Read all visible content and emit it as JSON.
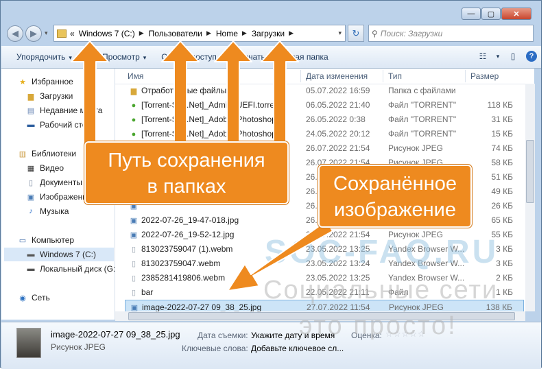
{
  "window": {
    "caption_buttons": [
      "—",
      "▢",
      "✕"
    ]
  },
  "nav": {
    "back": "◀",
    "forward": "▶",
    "dropdown": "▾"
  },
  "address": {
    "prefix": "«",
    "separator": "▶",
    "crumbs": [
      "Windows 7 (C:)",
      "Пользователи",
      "Home",
      "Загрузки"
    ],
    "dropdown": "▾"
  },
  "refresh_icon": "↻",
  "search": {
    "icon": "⚲",
    "placeholder": "Поиск: Загрузки"
  },
  "toolbar": {
    "organize": "Упорядочить",
    "preview": "Просмотр",
    "share": "Общий доступ",
    "print": "Печать",
    "new_folder": "Новая папка",
    "dropdown": "▾",
    "view_icon": "☷",
    "pane_icon": "▯",
    "help_icon": "?"
  },
  "nav_pane": {
    "favorites": "Избранное",
    "downloads": "Загрузки",
    "recent": "Недавние места",
    "desktop": "Рабочий стол",
    "libraries": "Библиотеки",
    "video": "Видео",
    "documents": "Документы",
    "images": "Изображения",
    "music": "Музыка",
    "computer": "Компьютер",
    "drive_c": "Windows 7 (C:)",
    "drive_g": "Локальный диск (G:)",
    "network": "Сеть"
  },
  "columns": {
    "name": "Имя",
    "date": "Дата изменения",
    "type": "Тип",
    "size": "Размер"
  },
  "files": [
    {
      "name": "Отработанные файлы",
      "date": "05.07.2022 16:59",
      "type": "Папка с файлами",
      "size": "",
      "icon": "folder-icon"
    },
    {
      "name": "[Torrent-Soft.Net]_Admin_UEFI.torrent",
      "date": "06.05.2022 21:40",
      "type": "Файл \"TORRENT\"",
      "size": "118 КБ",
      "icon": "torrent-icon"
    },
    {
      "name": "[Torrent-Soft.Net]_Adobe_Photoshop",
      "date": "26.05.2022 0:38",
      "type": "Файл \"TORRENT\"",
      "size": "31 КБ",
      "icon": "torrent-icon"
    },
    {
      "name": "[Torrent-Soft.Net]_Adobe_Photoshop",
      "date": "24.05.2022 20:12",
      "type": "Файл \"TORRENT\"",
      "size": "15 КБ",
      "icon": "torrent-icon"
    },
    {
      "name": "",
      "date": "26.07.2022 21:54",
      "type": "Рисунок JPEG",
      "size": "74 КБ",
      "icon": "image-icon"
    },
    {
      "name": "",
      "date": "26.07.2022 21:54",
      "type": "Рисунок JPEG",
      "size": "58 КБ",
      "icon": "image-icon"
    },
    {
      "name": "",
      "date": "26.07.2022 21:54",
      "type": "Рисунок JPEG",
      "size": "51 КБ",
      "icon": "image-icon"
    },
    {
      "name": "",
      "date": "26.07.2022 21:54",
      "type": "Рисунок JPEG",
      "size": "49 КБ",
      "icon": "image-icon"
    },
    {
      "name": "",
      "date": "26.07.2022 21:54",
      "type": "Рисунок JPEG",
      "size": "26 КБ",
      "icon": "image-icon"
    },
    {
      "name": "2022-07-26_19-47-018.jpg",
      "date": "26.07.2022 21:54",
      "type": "Рисунок JPEG",
      "size": "65 КБ",
      "icon": "image-icon"
    },
    {
      "name": "2022-07-26_19-52-12.jpg",
      "date": "26.07.2022 21:54",
      "type": "Рисунок JPEG",
      "size": "55 КБ",
      "icon": "image-icon"
    },
    {
      "name": "813023759047 (1).webm",
      "date": "23.05.2022 13:25",
      "type": "Yandex Browser W...",
      "size": "3 КБ",
      "icon": "webm-icon"
    },
    {
      "name": "813023759047.webm",
      "date": "23.05.2022 13:24",
      "type": "Yandex Browser W...",
      "size": "3 КБ",
      "icon": "webm-icon"
    },
    {
      "name": "2385281419806.webm",
      "date": "23.05.2022 13:25",
      "type": "Yandex Browser W...",
      "size": "2 КБ",
      "icon": "webm-icon"
    },
    {
      "name": "bar",
      "date": "22.05.2022 21:11",
      "type": "Файл",
      "size": "1 КБ",
      "icon": "file-icon"
    },
    {
      "name": "image-2022-07-27 09_38_25.jpg",
      "date": "27.07.2022 11:54",
      "type": "Рисунок JPEG",
      "size": "138 КБ",
      "icon": "image-icon"
    }
  ],
  "details": {
    "name": "image-2022-07-27 09_38_25.jpg",
    "type": "Рисунок JPEG",
    "date_label": "Дата съемки:",
    "date_value": "Укажите дату и время",
    "rating_label": "Оценка:",
    "rating_stars": "☆☆☆☆☆",
    "keywords_label": "Ключевые слова:",
    "keywords_value": "Добавьте ключевое сл..."
  },
  "callouts": {
    "path_line1": "Путь сохранения",
    "path_line2": "в папках",
    "saved_line1": "Сохранённое",
    "saved_line2": "изображение",
    "color": "#ee8a1f"
  },
  "watermark": {
    "brand": "SOC-FAQ.RU",
    "tagline1": "Социальные сети",
    "tagline2": "это просто!"
  }
}
